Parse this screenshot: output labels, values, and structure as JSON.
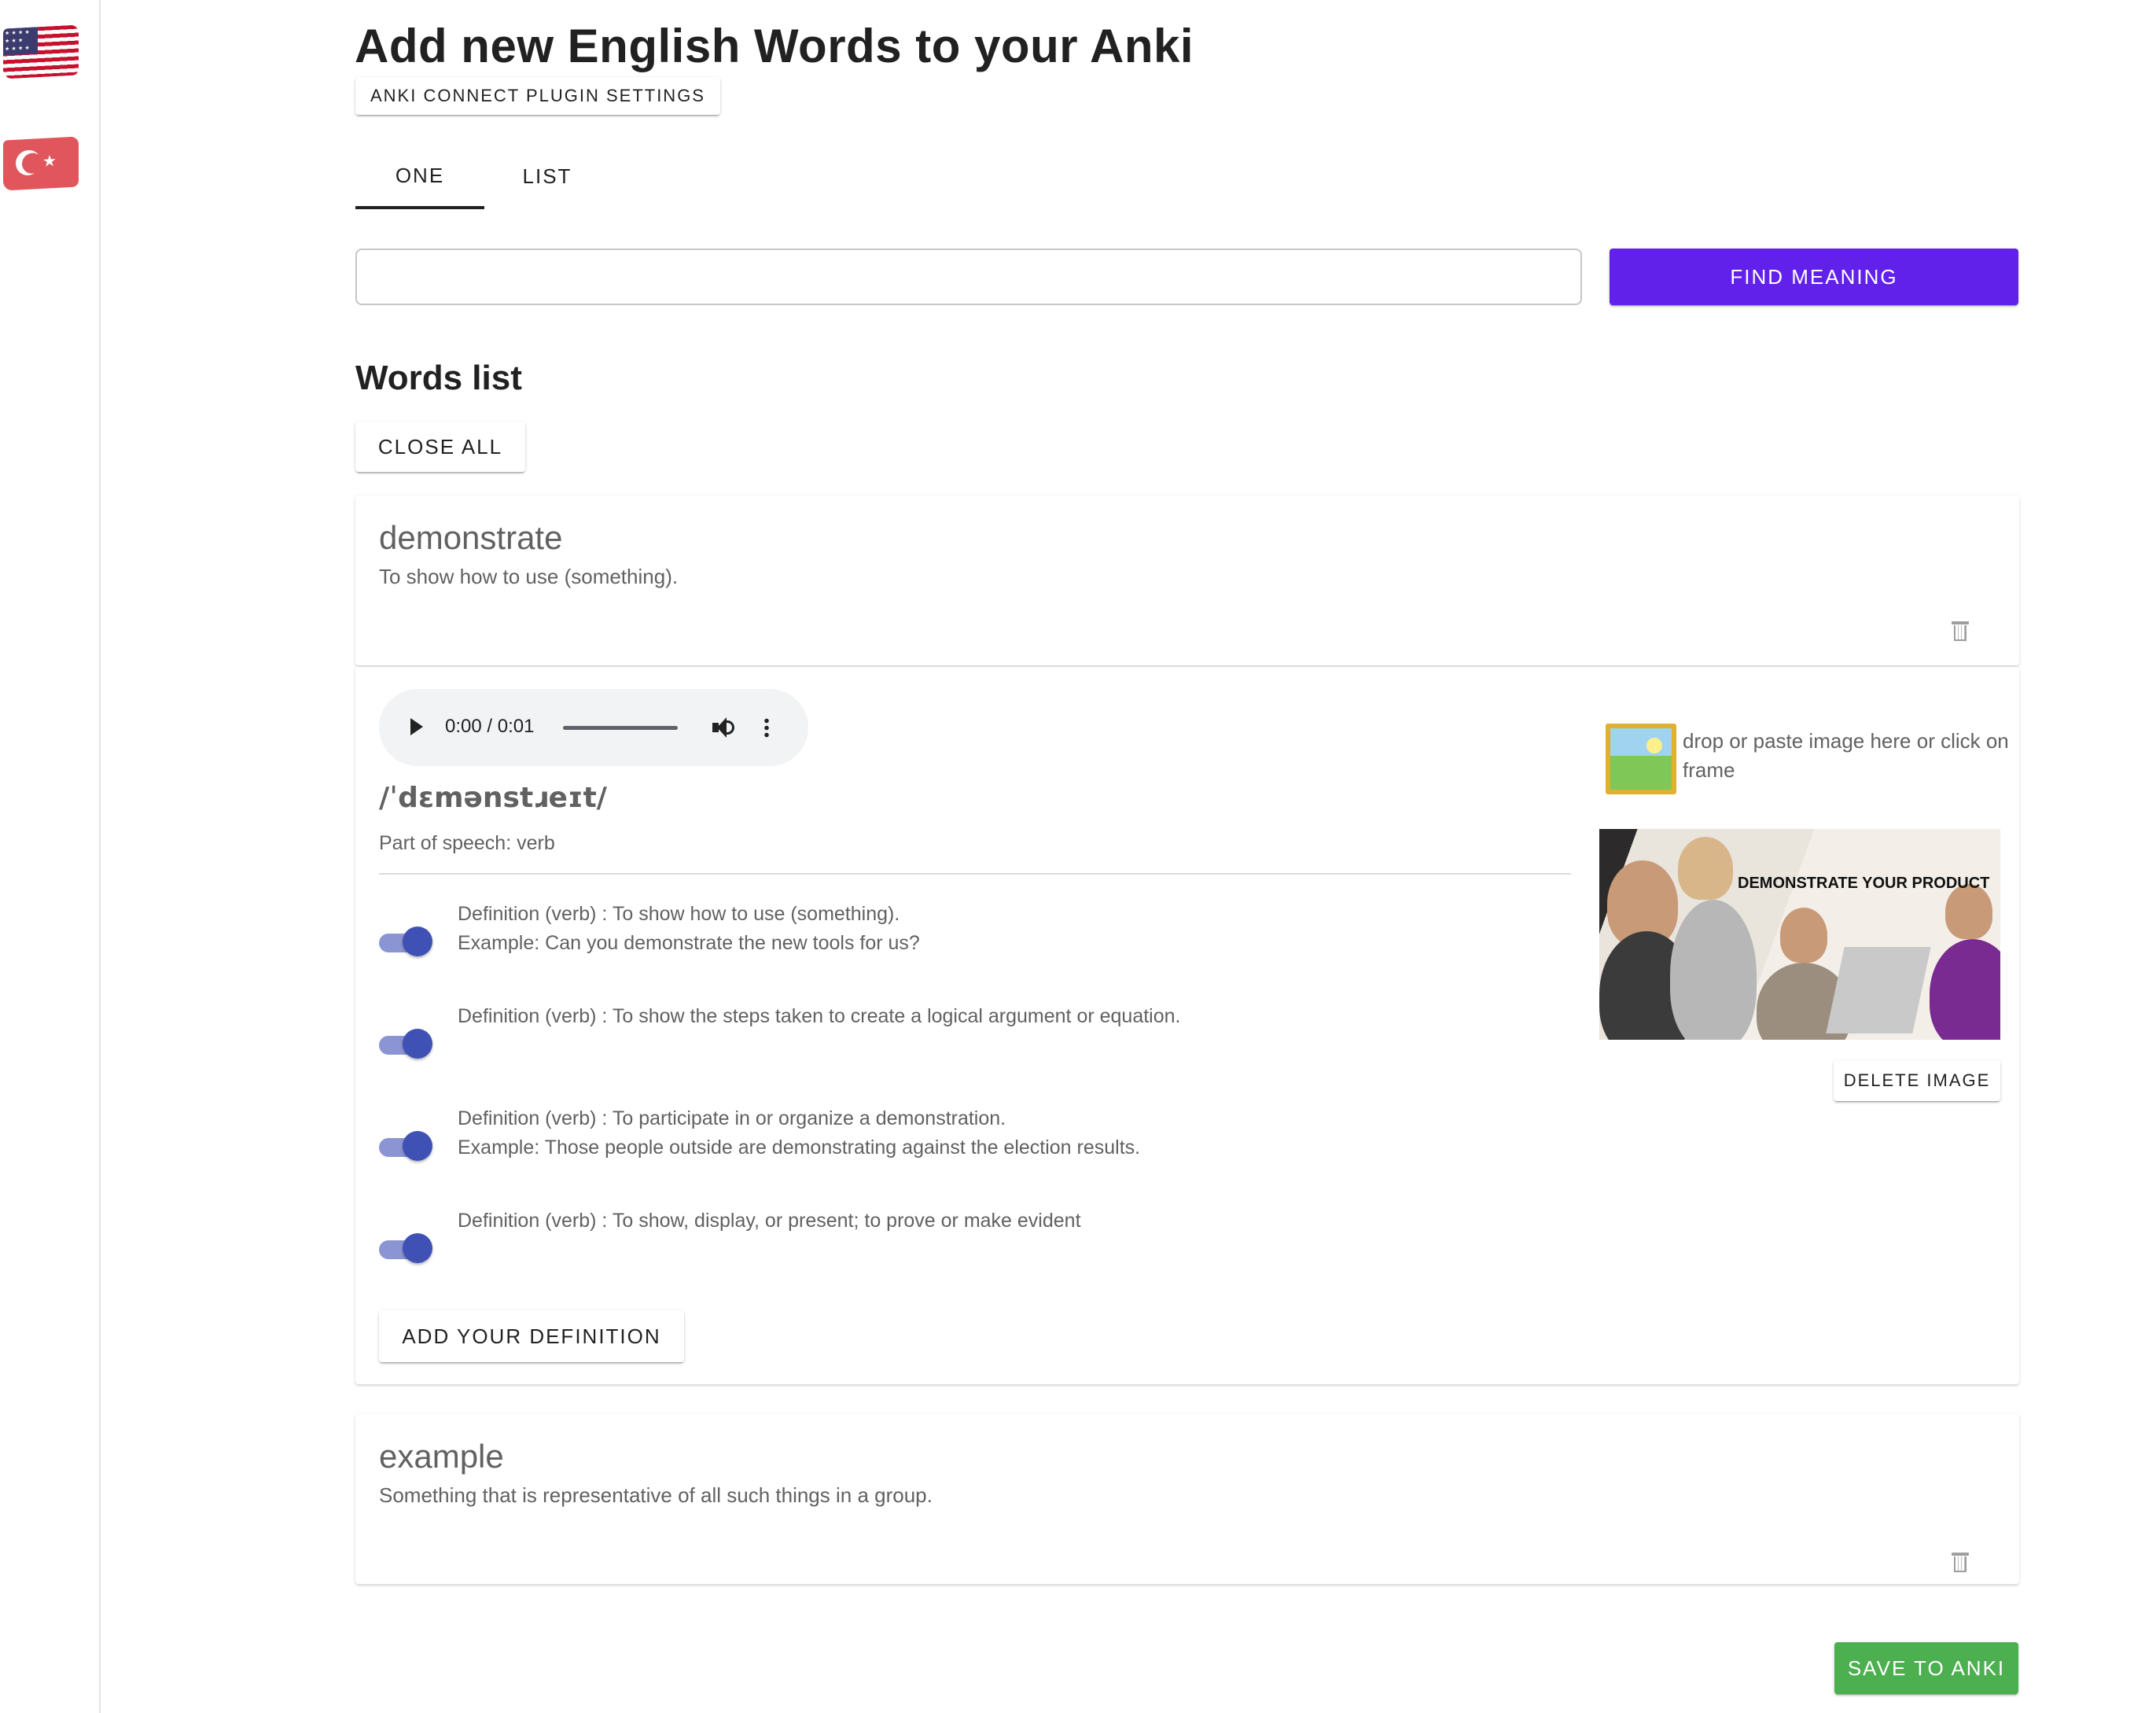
{
  "sidebar": {
    "languages": [
      {
        "name": "us-flag-icon"
      },
      {
        "name": "turkey-flag-icon"
      }
    ]
  },
  "header": {
    "title": "Add new English Words to your Anki",
    "settings_button": "ANKI CONNECT PLUGIN SETTINGS"
  },
  "tabs": [
    {
      "label": "ONE",
      "active": true
    },
    {
      "label": "LIST",
      "active": false
    }
  ],
  "search": {
    "value": "",
    "placeholder": "",
    "button_label": "FIND MEANING"
  },
  "words_list": {
    "heading": "Words list",
    "close_all_label": "CLOSE ALL",
    "words": [
      {
        "word": "demonstrate",
        "summary": "To show how to use (something).",
        "expanded": true,
        "audio": {
          "time": "0:00 / 0:01"
        },
        "phonetic": "/ˈdɛmənstɹeɪt/",
        "part_of_speech": "Part of speech: verb",
        "definitions": [
          {
            "definition": "Definition (verb) : To show how to use (something).",
            "example": "Example: Can you demonstrate the new tools for us?",
            "enabled": true
          },
          {
            "definition": "Definition (verb) : To show the steps taken to create a logical argument or equation.",
            "example": "",
            "enabled": true
          },
          {
            "definition": "Definition (verb) : To participate in or organize a demonstration.",
            "example": "Example: Those people outside are demonstrating against the election results.",
            "enabled": true
          },
          {
            "definition": "Definition (verb) : To show, display, or present; to prove or make evident",
            "example": "",
            "enabled": true
          }
        ],
        "add_definition_label": "ADD YOUR DEFINITION",
        "image": {
          "hint": "drop or paste image here or click on frame",
          "caption": "DEMONSTRATE YOUR PRODUCT",
          "delete_label": "DELETE IMAGE"
        }
      },
      {
        "word": "example",
        "summary": "Something that is representative of all such things in a group.",
        "expanded": false
      }
    ]
  },
  "save_label": "SAVE TO ANKI",
  "colors": {
    "primary": "#6221ea",
    "toggle": "#3f51b5",
    "save": "#4caf50"
  }
}
